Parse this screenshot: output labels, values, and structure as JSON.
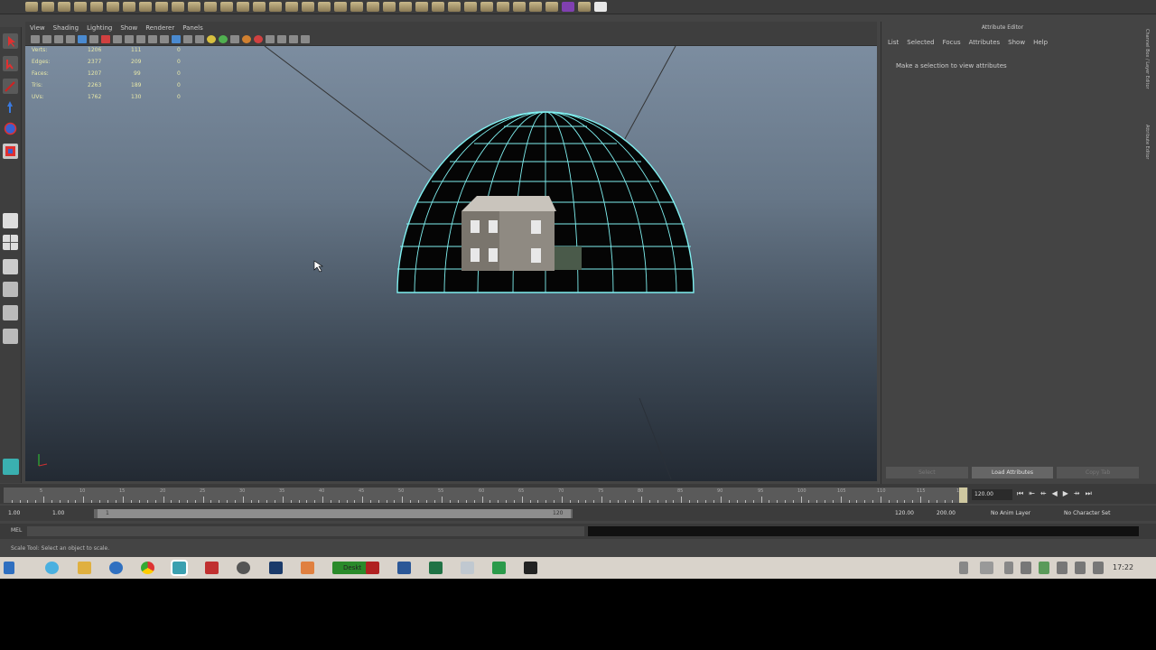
{
  "viewport": {
    "menus": [
      "View",
      "Shading",
      "Lighting",
      "Show",
      "Renderer",
      "Panels"
    ],
    "hud": [
      {
        "label": "Verts:",
        "c1": "1206",
        "c2": "111",
        "c3": "0"
      },
      {
        "label": "Edges:",
        "c1": "2377",
        "c2": "209",
        "c3": "0"
      },
      {
        "label": "Faces:",
        "c1": "1207",
        "c2": "99",
        "c3": "0"
      },
      {
        "label": "Tris:",
        "c1": "2263",
        "c2": "189",
        "c3": "0"
      },
      {
        "label": "UVs:",
        "c1": "1762",
        "c2": "130",
        "c3": "0"
      }
    ]
  },
  "attribute_editor": {
    "title": "Attribute Editor",
    "menus": [
      "List",
      "Selected",
      "Focus",
      "Attributes",
      "Show",
      "Help"
    ],
    "message": "Make a selection to view attributes",
    "buttons": {
      "select": "Select",
      "load": "Load Attributes",
      "copy": "Copy Tab"
    },
    "side_tabs": [
      "Channel Box / Layer Editor",
      "Attribute Editor"
    ]
  },
  "time_slider": {
    "labels": [
      "5",
      "10",
      "15",
      "20",
      "25",
      "30",
      "35",
      "40",
      "45",
      "50",
      "55",
      "60",
      "65",
      "70",
      "75",
      "80",
      "85",
      "90",
      "95",
      "100",
      "105",
      "110",
      "115",
      "120"
    ],
    "current_frame": "120.00",
    "end_marker": "120"
  },
  "range_slider": {
    "start": "1.00",
    "start_inner": "1.00",
    "handle_start": "1",
    "handle_end": "120",
    "end_inner": "120.00",
    "end": "200.00",
    "anim_layer": "No Anim Layer",
    "char_set": "No Character Set"
  },
  "command_line": {
    "label": "MEL"
  },
  "help_line": "Scale Tool: Select an object to scale.",
  "taskbar": {
    "clock": "17:22",
    "photoscan_label": "Deskt"
  }
}
